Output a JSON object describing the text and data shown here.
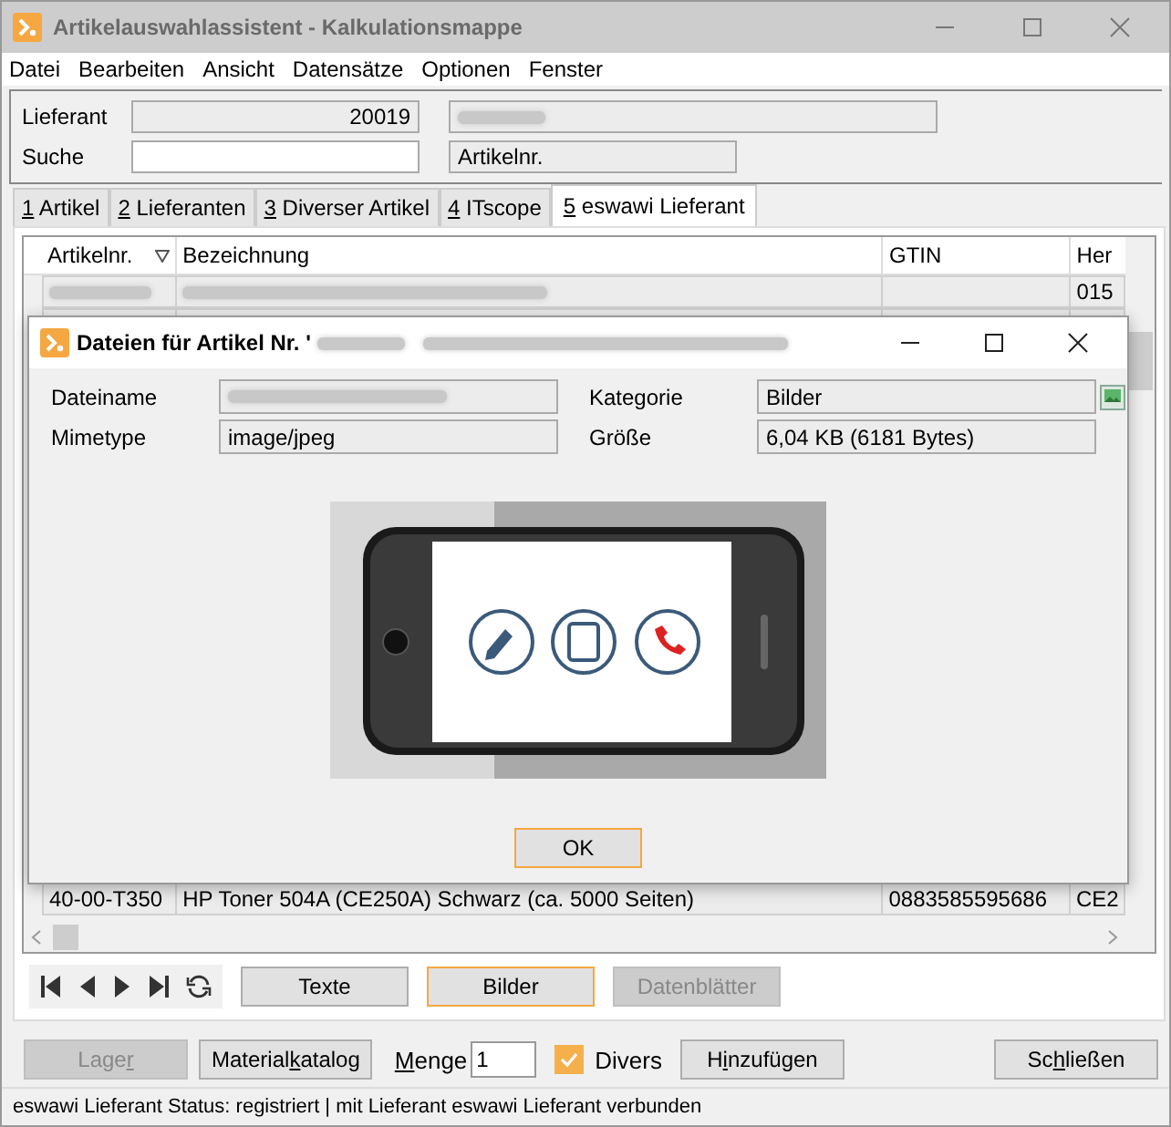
{
  "window": {
    "title": "Artikelauswahlassistent - Kalkulationsmappe"
  },
  "menu": [
    "Datei",
    "Bearbeiten",
    "Ansicht",
    "Datensätze",
    "Optionen",
    "Fenster"
  ],
  "form": {
    "lieferant_label": "Lieferant",
    "lieferant_value": "20019",
    "suche_label": "Suche",
    "search_by": "Artikelnr."
  },
  "tabs": [
    {
      "key": "1",
      "post": " Artikel",
      "selected": false
    },
    {
      "key": "2",
      "post": " Lieferanten",
      "selected": false
    },
    {
      "key": "3",
      "post": " Diverser Artikel",
      "selected": false
    },
    {
      "key": "4",
      "post": " ITscope",
      "selected": false
    },
    {
      "key": "5",
      "post": " eswawi Lieferant",
      "selected": true
    }
  ],
  "table": {
    "columns": [
      "Artikelnr.",
      "Bezeichnung",
      "GTIN",
      "Her"
    ],
    "top_rows": [
      {
        "column_4": "015"
      }
    ],
    "bottom_row": [
      "40-00-T350",
      "HP Toner 504A (CE250A) Schwarz (ca. 5000 Seiten)",
      "0883585595686",
      "CE2"
    ]
  },
  "dialog": {
    "title": "Dateien für Artikel Nr. '",
    "fields": [
      {
        "label": "Dateiname",
        "kind": "blurred"
      },
      {
        "label": "Kategorie",
        "kind": "category",
        "value": "Bilder"
      },
      {
        "label": "Mimetype",
        "kind": "text",
        "value": "image/jpeg"
      },
      {
        "label": "Größe",
        "kind": "text",
        "value": "6,04 KB (6181 Bytes)"
      }
    ],
    "ok": "OK"
  },
  "view_buttons": [
    {
      "label": "Texte",
      "selected": false,
      "disabled": false
    },
    {
      "label": "Bilder",
      "selected": true,
      "disabled": false
    },
    {
      "label": "Datenblätter",
      "selected": false,
      "disabled": true
    }
  ],
  "actions": {
    "lager": {
      "pre": "Lage",
      "key": "r",
      "disabled": true
    },
    "katalog": {
      "pre": "Material",
      "key": "k",
      "post": "atalog",
      "disabled": false
    },
    "menge_label": {
      "key": "M",
      "post": "enge"
    },
    "menge_value": "1",
    "divers": {
      "label": "Divers",
      "checked": true
    },
    "add": {
      "pre": "H",
      "key": "i",
      "post": "nzufügen",
      "disabled": false
    },
    "close": {
      "pre": "Sc",
      "key": "h",
      "post": "ließen",
      "disabled": false
    }
  },
  "status_bar": "eswawi Lieferant Status: registriert | mit Lieferant eswawi Lieferant verbunden"
}
